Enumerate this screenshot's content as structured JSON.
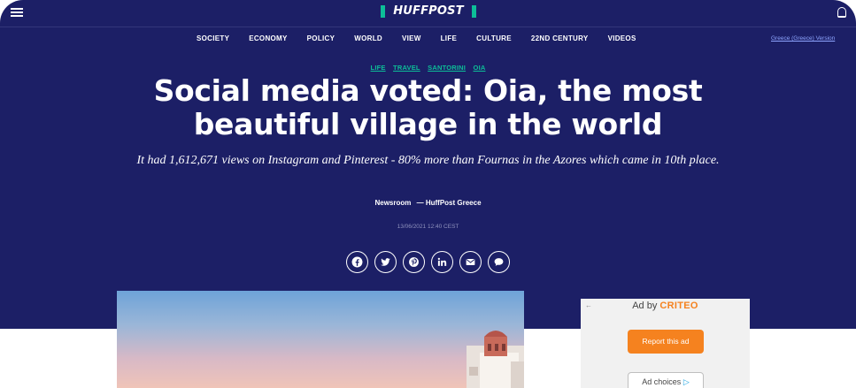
{
  "brand": {
    "logo_text": "HUFFPOST",
    "accent": "#0dbe98",
    "background": "#1c1f66"
  },
  "icons": {
    "menu": "hamburger-icon",
    "notifications": "bell-icon"
  },
  "nav": {
    "items": [
      "SOCIETY",
      "ECONOMY",
      "POLICY",
      "WORLD",
      "VIEW",
      "LIFE",
      "CULTURE",
      "22ND CENTURY",
      "VIDEOS"
    ],
    "edition_link": "Greece (Greece) Version"
  },
  "article": {
    "tags": [
      "LIFE",
      "TRAVEL",
      "SANTORINI",
      "OIA"
    ],
    "title": "Social media voted: Oia, the most beautiful village in the world",
    "subtitle": "It had 1,612,671 views on Instagram and Pinterest - 80% more than Fournas in the Azores which came in 10th place.",
    "author": "Newsroom",
    "source": "— HuffPost Greece",
    "timestamp": "13/06/2021 12:40 CEST"
  },
  "share": {
    "buttons": [
      "facebook-icon",
      "twitter-icon",
      "pinterest-icon",
      "linkedin-icon",
      "email-icon",
      "comment-icon"
    ]
  },
  "ad": {
    "label_prefix": "Ad by",
    "label_brand": "CRITEO",
    "back_arrow": "←",
    "report_button": "Report this ad",
    "choices_button": "Ad choices",
    "choices_glyph": "▷",
    "brand_color": "#f5821f"
  }
}
